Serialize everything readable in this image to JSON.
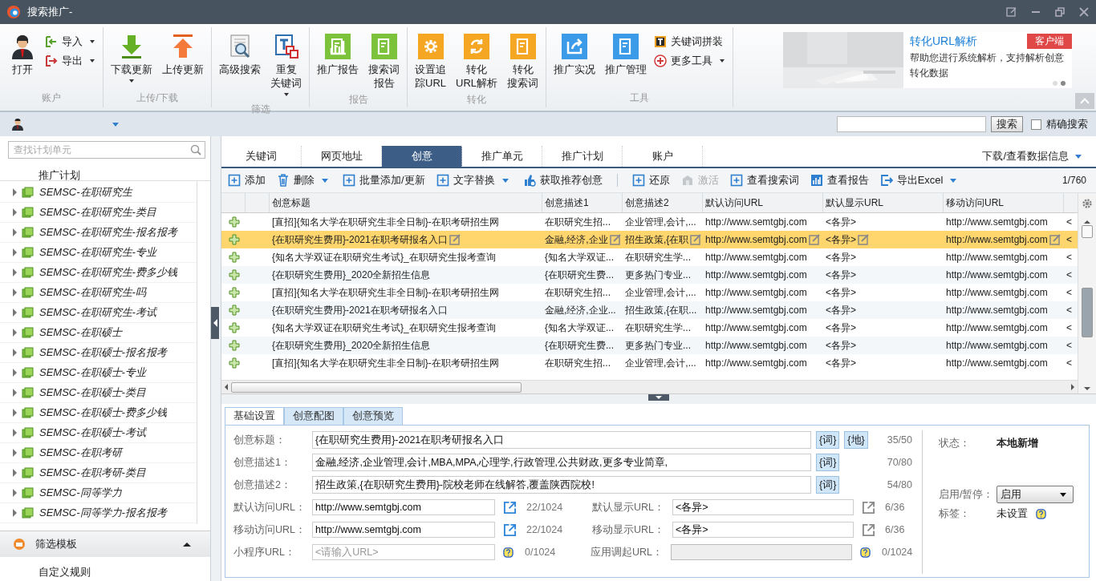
{
  "window": {
    "title": "搜索推广-"
  },
  "ribbon": {
    "groups": [
      {
        "label": "账户",
        "buttons": [
          {
            "label": "打开",
            "kind": "large",
            "menu": false
          },
          {
            "label": "导入",
            "kind": "small",
            "menu": true
          },
          {
            "label": "导出",
            "kind": "small",
            "menu": true
          }
        ]
      },
      {
        "label": "上传/下载",
        "buttons": [
          {
            "label": "下载更新",
            "kind": "large",
            "menu": true
          },
          {
            "label": "上传更新",
            "kind": "large",
            "menu": false
          }
        ]
      },
      {
        "label": "筛选",
        "buttons": [
          {
            "label": "高级搜索",
            "kind": "large",
            "menu": false
          },
          {
            "lines": [
              "重复",
              "关键词"
            ],
            "kind": "large",
            "menu": true
          }
        ]
      },
      {
        "label": "报告",
        "buttons": [
          {
            "label": "推广报告",
            "kind": "large",
            "menu": false
          },
          {
            "lines": [
              "搜索词",
              "报告"
            ],
            "kind": "large",
            "menu": false
          }
        ]
      },
      {
        "label": "转化",
        "buttons": [
          {
            "lines": [
              "设置追",
              "踪URL"
            ],
            "kind": "large",
            "menu": false
          },
          {
            "lines": [
              "转化",
              "URL解析"
            ],
            "kind": "large",
            "menu": false
          },
          {
            "lines": [
              "转化",
              "搜索词"
            ],
            "kind": "large",
            "menu": false
          }
        ]
      },
      {
        "label": "工具",
        "buttons": [
          {
            "label": "推广实况",
            "kind": "large",
            "menu": false
          },
          {
            "label": "推广管理",
            "kind": "large",
            "menu": false
          },
          {
            "label": "关键词拼装",
            "kind": "small",
            "menu": false
          },
          {
            "label": "更多工具",
            "kind": "small",
            "menu": true
          }
        ]
      }
    ]
  },
  "promo": {
    "title": "转化URL解析",
    "badge": "客户端",
    "text": "帮助您进行系统解析，支持解析创意转化数据",
    "dots": [
      {
        "selected": false
      },
      {
        "selected": true
      }
    ]
  },
  "account_bar": {
    "search_button": "搜索",
    "exact_search": {
      "label": "精确搜索",
      "checked": false
    }
  },
  "sidebar": {
    "search": {
      "placeholder": "查找计划单元"
    },
    "title": "推广计划",
    "items": [
      {
        "label": "SEMSC-在职研究生",
        "expanded": false
      },
      {
        "label": "SEMSC-在职研究生-类目",
        "expanded": false
      },
      {
        "label": "SEMSC-在职研究生-报名报考",
        "expanded": false
      },
      {
        "label": "SEMSC-在职研究生-专业",
        "expanded": false
      },
      {
        "label": "SEMSC-在职研究生-费多少钱",
        "expanded": false
      },
      {
        "label": "SEMSC-在职研究生-吗",
        "expanded": false
      },
      {
        "label": "SEMSC-在职研究生-考试",
        "expanded": false
      },
      {
        "label": "SEMSC-在职硕士",
        "expanded": false
      },
      {
        "label": "SEMSC-在职硕士-报名报考",
        "expanded": false
      },
      {
        "label": "SEMSC-在职硕士-专业",
        "expanded": false
      },
      {
        "label": "SEMSC-在职硕士-类目",
        "expanded": false
      },
      {
        "label": "SEMSC-在职硕士-费多少钱",
        "expanded": false
      },
      {
        "label": "SEMSC-在职硕士-考试",
        "expanded": false
      },
      {
        "label": "SEMSC-在职考研",
        "expanded": false
      },
      {
        "label": "SEMSC-在职考研-类目",
        "expanded": false
      },
      {
        "label": "SEMSC-同等学力",
        "expanded": false
      },
      {
        "label": "SEMSC-同等学力-报名报考",
        "expanded": false
      }
    ],
    "filter_panel": {
      "title": "筛选模板",
      "expanded": true
    },
    "custom_rule": "自定义规则"
  },
  "tabs": [
    {
      "label": "关键词",
      "selected": false
    },
    {
      "label": "网页地址",
      "selected": false
    },
    {
      "label": "创意",
      "selected": true
    },
    {
      "label": "推广单元",
      "selected": false
    },
    {
      "label": "推广计划",
      "selected": false
    },
    {
      "label": "账户",
      "selected": false
    }
  ],
  "data_menu": "下载/查看数据信息",
  "toolbar": {
    "left": [
      {
        "label": "添加",
        "menu": false,
        "disabled": false
      },
      {
        "label": "删除",
        "menu": true,
        "disabled": false
      },
      {
        "label": "批量添加/更新",
        "menu": false,
        "disabled": false
      },
      {
        "label": "文字替换",
        "menu": true,
        "disabled": false
      },
      {
        "label": "获取推荐创意",
        "menu": false,
        "disabled": false
      }
    ],
    "right": [
      {
        "label": "还原",
        "menu": false,
        "disabled": false
      },
      {
        "label": "激活",
        "menu": false,
        "disabled": true
      },
      {
        "label": "查看搜索词",
        "menu": false,
        "disabled": false
      },
      {
        "label": "查看报告",
        "menu": false,
        "disabled": false
      },
      {
        "label": "导出Excel",
        "menu": true,
        "disabled": false
      }
    ],
    "page": "1/760"
  },
  "table": {
    "columns": [
      "创意标题",
      "创意描述1",
      "创意描述2",
      "默认访问URL",
      "默认显示URL",
      "移动访问URL"
    ],
    "rows": [
      {
        "selected": false,
        "cells": [
          "[直招]{知名大学在职研究生非全日制}-在职考研招生网",
          "在职研究生招...",
          "企业管理,会计,...",
          "http://www.semtgbj.com",
          "<各异>",
          "http://www.semtgbj.com",
          "<"
        ]
      },
      {
        "selected": true,
        "cells": [
          "{在职研究生费用}-2021在职考研报名入口",
          "金融,经济,企业",
          "招生政策,{在职",
          "http://www.semtgbj.com",
          "<各异>",
          "http://www.semtgbj.com",
          "<"
        ]
      },
      {
        "selected": false,
        "cells": [
          "{知名大学双证在职研究生考试}_在职研究生报考查询",
          "{知名大学双证...",
          "在职研究生学...",
          "http://www.semtgbj.com",
          "<各异>",
          "http://www.semtgbj.com",
          "<"
        ]
      },
      {
        "selected": false,
        "cells": [
          "{在职研究生费用}_2020全新招生信息",
          "{在职研究生费...",
          "更多热门专业...",
          "http://www.semtgbj.com",
          "<各异>",
          "http://www.semtgbj.com",
          "<"
        ]
      },
      {
        "selected": false,
        "cells": [
          "[直招]{知名大学在职研究生非全日制}-在职考研招生网",
          "在职研究生招...",
          "企业管理,会计,...",
          "http://www.semtgbj.com",
          "<各异>",
          "http://www.semtgbj.com",
          "<"
        ]
      },
      {
        "selected": false,
        "cells": [
          "{在职研究生费用}-2021在职考研报名入口",
          "金融,经济,企业...",
          "招生政策,{在职...",
          "http://www.semtgbj.com",
          "<各异>",
          "http://www.semtgbj.com",
          "<"
        ]
      },
      {
        "selected": false,
        "cells": [
          "{知名大学双证在职研究生考试}_在职研究生报考查询",
          "{知名大学双证...",
          "在职研究生学...",
          "http://www.semtgbj.com",
          "<各异>",
          "http://www.semtgbj.com",
          "<"
        ]
      },
      {
        "selected": false,
        "cells": [
          "{在职研究生费用}_2020全新招生信息",
          "{在职研究生费...",
          "更多热门专业...",
          "http://www.semtgbj.com",
          "<各异>",
          "http://www.semtgbj.com",
          "<"
        ]
      },
      {
        "selected": false,
        "cells": [
          "[直招]{知名大学在职研究生非全日制}-在职考研招生网",
          "在职研究生招...",
          "企业管理,会计,...",
          "http://www.semtgbj.com",
          "<各异>",
          "http://www.semtgbj.com",
          "<"
        ]
      }
    ]
  },
  "detail": {
    "tabs": [
      {
        "label": "基础设置",
        "selected": true
      },
      {
        "label": "创意配图",
        "selected": false
      },
      {
        "label": "创意预览",
        "selected": false
      }
    ],
    "text_fields": [
      {
        "label": "创意标题：",
        "value": "{在职研究生费用}-2021在职考研报名入口",
        "tokens": [
          "{词}",
          "{地}"
        ],
        "count": "35/50"
      },
      {
        "label": "创意描述1：",
        "value": "金融,经济,企业管理,会计,MBA,MPA,心理学,行政管理,公共财政,更多专业简章,",
        "tokens": [
          "{词}"
        ],
        "count": "70/80"
      },
      {
        "label": "创意描述2：",
        "value": "招生政策,{在职研究生费用}-院校老师在线解答,覆盖陕西院校!",
        "tokens": [
          "{词}"
        ],
        "count": "54/80"
      }
    ],
    "url_rows": [
      [
        {
          "label": "默认访问URL：",
          "value": "http://www.semtgbj.com",
          "kind": "link",
          "disabled": false,
          "count": "22/1024"
        },
        {
          "label": "默认显示URL：",
          "value": "<各异>",
          "kind": "display",
          "disabled": false,
          "count": "6/36"
        }
      ],
      [
        {
          "label": "移动访问URL：",
          "value": "http://www.semtgbj.com",
          "kind": "link",
          "disabled": false,
          "count": "22/1024"
        },
        {
          "label": "移动显示URL：",
          "value": "<各异>",
          "kind": "display",
          "disabled": false,
          "count": "6/36"
        }
      ],
      [
        {
          "label": "小程序URL：",
          "placeholder": "<请输入URL>",
          "kind": "help",
          "disabled": false,
          "count": "0/1024"
        },
        {
          "label": "应用调起URL：",
          "kind": "help",
          "disabled": true,
          "count": "0/1024"
        }
      ]
    ],
    "status": [
      {
        "label": "状态：",
        "value": "本地新增",
        "kind": "bold"
      },
      {
        "label": "启用/暂停：",
        "value": "启用",
        "kind": "select"
      },
      {
        "label": "标签：",
        "value": "未设置",
        "kind": "help"
      }
    ]
  }
}
